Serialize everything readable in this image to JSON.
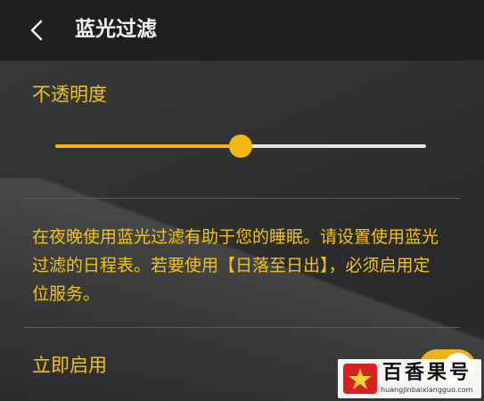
{
  "header": {
    "title": "蓝光过滤",
    "back_icon": "chevron-left-icon"
  },
  "opacity": {
    "label": "不透明度",
    "level": 0.5
  },
  "description": "在夜晚使用蓝光过滤有助于您的睡眠。请设置使用蓝光过滤的日程表。若要使用【日落至日出】，必须启用定位服务。",
  "enable_now": {
    "label": "立即启用",
    "on": true
  },
  "watermark": {
    "name": "百香果号",
    "url": "huangjinbaixiangguo.com"
  },
  "colors": {
    "accent": "#f4c21a",
    "header_bg": "#1f1f1f",
    "background": "#2c2c2c"
  }
}
